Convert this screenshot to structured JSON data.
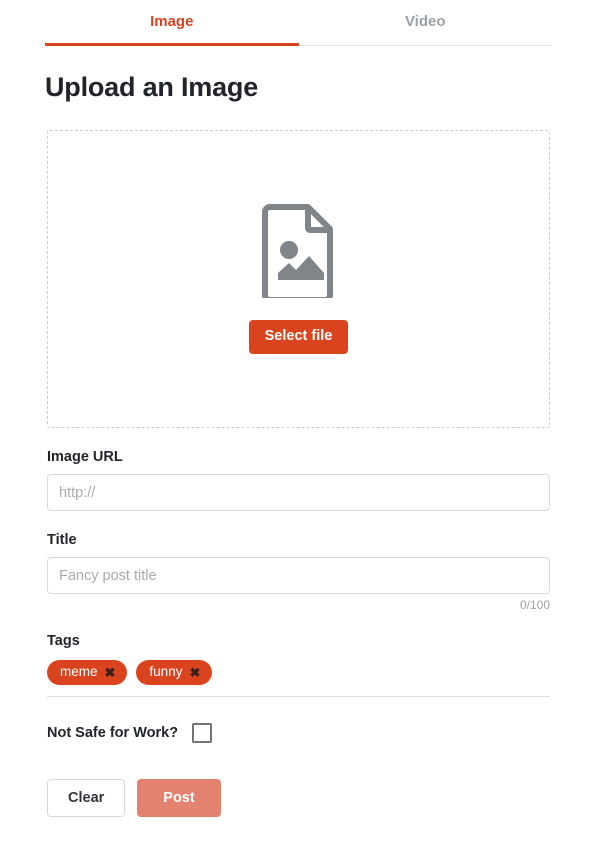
{
  "tabs": [
    {
      "label": "Image",
      "active": true
    },
    {
      "label": "Video",
      "active": false
    }
  ],
  "page_title": "Upload an Image",
  "dropzone": {
    "icon": "image-file-icon",
    "select_button_label": "Select file"
  },
  "form": {
    "image_url": {
      "label": "Image URL",
      "placeholder": "http://",
      "value": ""
    },
    "title": {
      "label": "Title",
      "placeholder": "Fancy post title",
      "value": "",
      "counter": "0/100"
    },
    "tags": {
      "label": "Tags",
      "items": [
        {
          "label": "meme",
          "remove_icon": "close-icon"
        },
        {
          "label": "funny",
          "remove_icon": "close-icon"
        }
      ]
    },
    "nsfw": {
      "label": "Not Safe for Work?",
      "checked": false
    }
  },
  "actions": {
    "clear_label": "Clear",
    "post_label": "Post"
  },
  "colors": {
    "accent": "#d9441f",
    "accent_muted": "#e3836f",
    "text": "#21252a",
    "muted_text": "#9aa0a6",
    "border": "#d8dadd",
    "dashed_border": "#c9ccd0",
    "icon_gray": "#80858a"
  }
}
